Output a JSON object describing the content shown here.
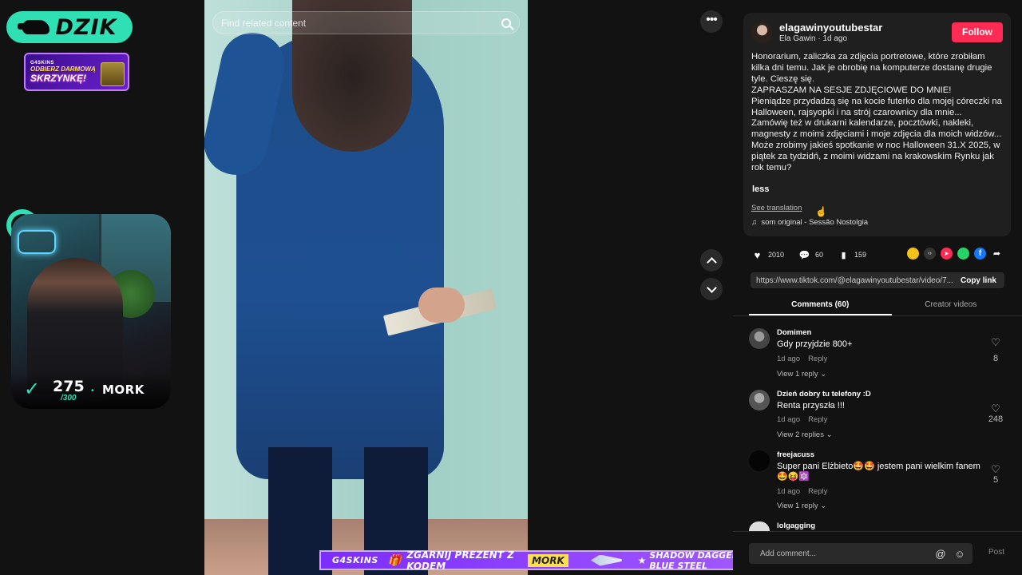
{
  "overlay": {
    "brand": "DZIK",
    "ad": {
      "l1": "G4SKINS",
      "l2": "ODBIERZ DARMOWĄ",
      "l3": "SKRZYNKĘ!"
    },
    "subs": {
      "count": "275",
      "goal": "/300",
      "name": "MORK"
    }
  },
  "video": {
    "search_placeholder": "Find related content"
  },
  "banner": {
    "brand": "G4SKINS",
    "promo": "ZGARNIJ PREZENT Z KODEM",
    "code": "MORK",
    "skin": "SHADOW DAGGERS | BLUE STEEL"
  },
  "post": {
    "username": "elagawinyoutubestar",
    "display_name": "Ela Gawin",
    "age": "1d ago",
    "follow_label": "Follow",
    "description": [
      "Honorarium, zaliczka za zdjęcia portretowe, które zrobiłam kilka dni temu. Jak je obrobię na komputerze dostanę drugie tyle. Cieszę się.",
      "ZAPRASZAM NA SESJE ZDJĘCIOWE DO MNIE!",
      "Pieniądze przydadzą się na kocie futerko dla mojej córeczki na Halloween, rajsyopki i na strój czarownicy dla mnie...",
      "Zamówię też w drukarni kalendarze, pocztówki, nakleki, magnesty z moimi zdjęciami i moje zdjęcia dla moich widzów...",
      "Może zrobimy jakieś spotkanie w noc Halloween 31.X 2025, w piątek za tydzidń, z moimi widzami na krakowskim Rynku jak rok temu?"
    ],
    "less_label": "less",
    "see_translation": "See translation",
    "music": "som original - Sessão Nostolgia",
    "likes": "2010",
    "comments": "60",
    "saves": "159",
    "link": "https://www.tiktok.com/@elagawinyoutubestar/video/7...",
    "copy_label": "Copy link"
  },
  "tabs": [
    {
      "label": "Comments (60)"
    },
    {
      "label": "Creator videos"
    }
  ],
  "comments": [
    {
      "user": "Domimen",
      "text": "Gdy przyjdzie 800+",
      "time": "1d ago",
      "reply": "Reply",
      "likes": "8",
      "replies": "View 1 reply"
    },
    {
      "user": "Dzień dobry tu telefony :D",
      "text": "Renta przyszła !!!",
      "time": "1d ago",
      "reply": "Reply",
      "likes": "248",
      "replies": "View 2 replies"
    },
    {
      "user": "freejacuss",
      "text": "Super pani Elżbieto🤩🤩 jestem pani wielkim fanem 🤩😝🔯",
      "time": "1d ago",
      "reply": "Reply",
      "likes": "5",
      "replies": "View 1 reply"
    },
    {
      "user": "lolgagging"
    }
  ],
  "composer": {
    "placeholder": "Add comment...",
    "post_label": "Post"
  },
  "colors": {
    "accent": "#2fe0b4",
    "follow": "#fe2c55",
    "banner": "#8a3dff"
  }
}
